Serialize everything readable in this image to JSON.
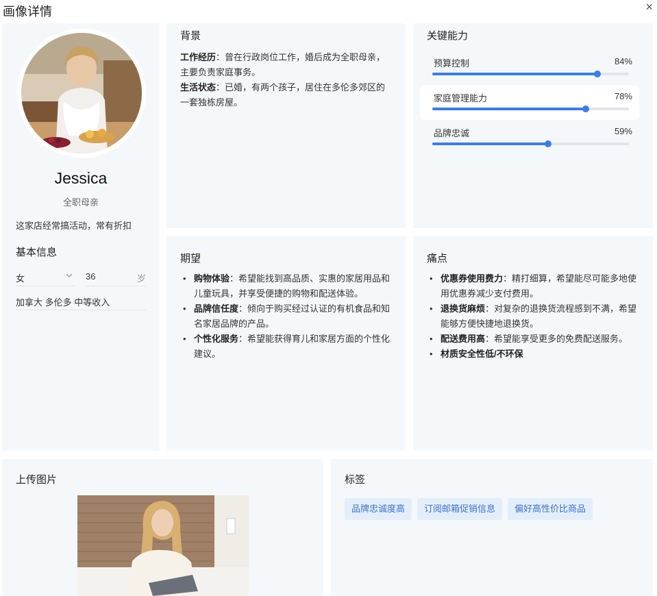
{
  "header": {
    "title": "画像详情",
    "close_label": "×"
  },
  "profile": {
    "name": "Jessica",
    "role": "全职母亲",
    "slogan": "这家店经常搞活动，常有折扣",
    "basic_title": "基本信息",
    "gender": "女",
    "age": "36",
    "age_unit": "岁",
    "location_income": "加拿大 多伦多 中等收入"
  },
  "background": {
    "title": "背景",
    "items": [
      {
        "label": "工作经历",
        "text": "：曾在行政岗位工作，婚后成为全职母亲，主要负责家庭事务。"
      },
      {
        "label": "生活状态",
        "text": "：已婚，有两个孩子，居住在多伦多郊区的一套独栋房屋。"
      }
    ]
  },
  "abilities": {
    "title": "关键能力",
    "items": [
      {
        "label": "预算控制",
        "value": 84,
        "value_text": "84%"
      },
      {
        "label": "家庭管理能力",
        "value": 78,
        "value_text": "78%"
      },
      {
        "label": "品牌忠诚",
        "value": 59,
        "value_text": "59%"
      }
    ]
  },
  "expectations": {
    "title": "期望",
    "items": [
      {
        "label": "购物体验",
        "text": "：希望能找到高品质、实惠的家居用品和儿童玩具，并享受便捷的购物和配送体验。"
      },
      {
        "label": "品牌信任度",
        "text": "：倾向于购买经过认证的有机食品和知名家居品牌的产品。"
      },
      {
        "label": "个性化服务",
        "text": "：希望能获得育儿和家居方面的个性化建议。"
      }
    ]
  },
  "pain_points": {
    "title": "痛点",
    "items": [
      {
        "label": "优惠券使用费力",
        "text": "：精打细算，希望能尽可能多地使用优惠券减少支付费用。"
      },
      {
        "label": "退换货麻烦",
        "text": "：对复杂的退换货流程感到不满，希望能够方便快捷地退换货。"
      },
      {
        "label": "配送费用高",
        "text": "：希望能享受更多的免费配送服务。"
      },
      {
        "label": "材质安全性低/不环保",
        "text": ""
      }
    ]
  },
  "upload": {
    "title": "上传图片"
  },
  "tags": {
    "title": "标签",
    "items": [
      "品牌忠诚度高",
      "订阅邮箱促销信息",
      "偏好高性价比商品"
    ]
  }
}
